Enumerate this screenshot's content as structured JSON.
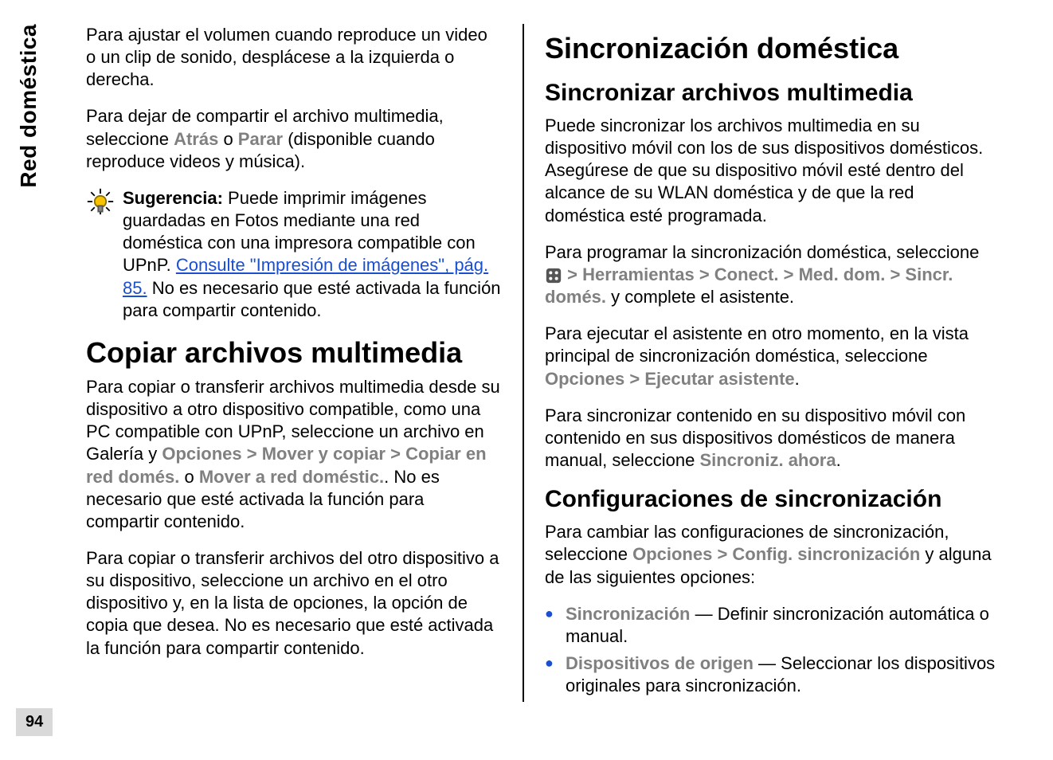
{
  "sideTab": "Red doméstica",
  "pageNumber": "94",
  "left": {
    "p1_a": "Para ajustar el volumen cuando reproduce un video o un clip de sonido, desplácese a la izquierda o derecha.",
    "p2_a": "Para dejar de compartir el archivo multimedia, seleccione ",
    "p2_b": "Atrás",
    "p2_c": " o ",
    "p2_d": "Parar",
    "p2_e": " (disponible cuando reproduce videos y música).",
    "tip": {
      "label": "Sugerencia:",
      "a": " Puede imprimir imágenes guardadas en Fotos mediante una red doméstica con una impresora compatible con UPnP. ",
      "link": "Consulte \"Impresión de imágenes\", pág. 85.",
      "b": " No es necesario que esté activada la función para compartir contenido."
    },
    "h1": "Copiar archivos multimedia",
    "p3_a": "Para copiar o transferir archivos multimedia desde su dispositivo a otro dispositivo compatible, como una PC compatible con UPnP, seleccione un archivo en Galería y ",
    "p3_b": "Opciones",
    "p3_c": "Mover y copiar",
    "p3_d": "Copiar en red domés.",
    "p3_e": " o ",
    "p3_f": "Mover a red doméstic.",
    "p3_g": ". No es necesario que esté activada la función para compartir contenido.",
    "p4": "Para copiar o transferir archivos del otro dispositivo a su dispositivo, seleccione un archivo en el otro dispositivo y, en la lista de opciones, la opción de copia que desea. No es necesario que esté activada la función para compartir contenido."
  },
  "right": {
    "h1": "Sincronización doméstica",
    "h2a": "Sincronizar archivos multimedia",
    "p1": "Puede sincronizar los archivos multimedia en su dispositivo móvil con los de sus dispositivos domésticos. Asegúrese de que su dispositivo móvil esté dentro del alcance de su WLAN doméstica y de que la red doméstica esté programada.",
    "p2_a": "Para programar la sincronización doméstica, seleccione ",
    "p2_b": "Herramientas",
    "p2_c": "Conect.",
    "p2_d": "Med. dom.",
    "p2_e": "Sincr. domés.",
    "p2_f": " y complete el asistente.",
    "p3_a": "Para ejecutar el asistente en otro momento, en la vista principal de sincronización doméstica, seleccione ",
    "p3_b": "Opciones",
    "p3_c": "Ejecutar asistente",
    "p3_d": ".",
    "p4_a": "Para sincronizar contenido en su dispositivo móvil con contenido en sus dispositivos domésticos de manera manual, seleccione ",
    "p4_b": "Sincroniz. ahora",
    "p4_c": ".",
    "h2b": "Configuraciones de sincronización",
    "p5_a": "Para cambiar las configuraciones de sincronización, seleccione ",
    "p5_b": "Opciones",
    "p5_c": "Config. sincronización",
    "p5_d": " y alguna de las siguientes opciones:",
    "bullets": {
      "b1_a": "Sincronización",
      "b1_b": "  — Definir sincronización automática o manual.",
      "b2_a": "Dispositivos de origen",
      "b2_b": "  — Seleccionar los dispositivos originales para sincronización."
    }
  },
  "sep": " > "
}
